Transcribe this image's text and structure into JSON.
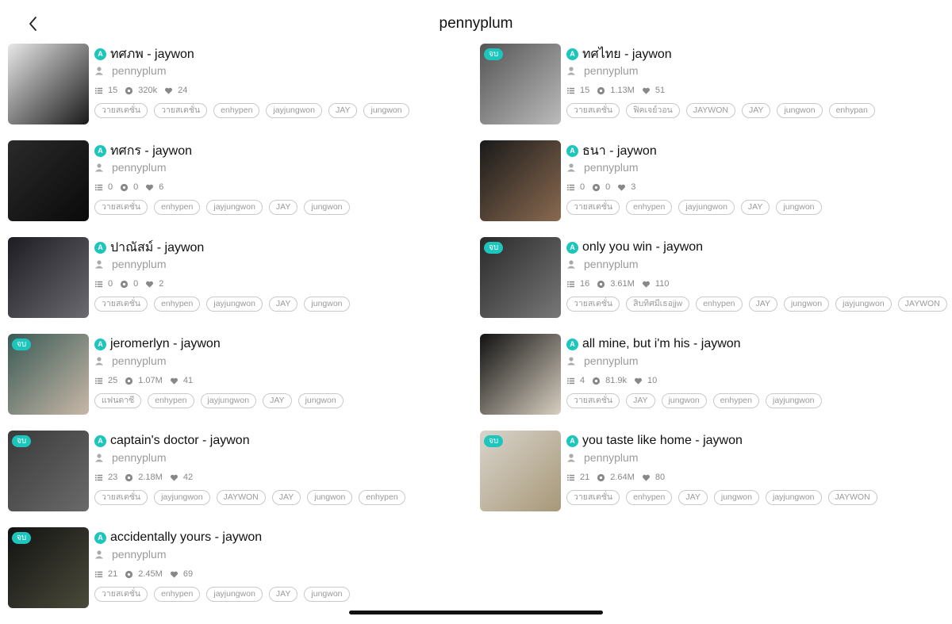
{
  "header": {
    "title": "pennyplum"
  },
  "colors": {
    "accent": "#1dc6bd"
  },
  "badge_letter": "A",
  "columns": {
    "left": [
      {
        "title": "ทศภพ - jaywon",
        "author": "pennyplum",
        "chapters": "15",
        "views": "320k",
        "likes": "24",
        "finished": false,
        "tags": [
          "วายสเตชั่น",
          "วายสเตชั่น",
          "enhypen",
          "jayjungwon",
          "JAY",
          "jungwon"
        ]
      },
      {
        "title": "ทศกร - jaywon",
        "author": "pennyplum",
        "chapters": "0",
        "views": "0",
        "likes": "6",
        "finished": false,
        "tags": [
          "วายสเตชั่น",
          "enhypen",
          "jayjungwon",
          "JAY",
          "jungwon"
        ]
      },
      {
        "title": "ปาณัสม์ - jaywon",
        "author": "pennyplum",
        "chapters": "0",
        "views": "0",
        "likes": "2",
        "finished": false,
        "tags": [
          "วายสเตชั่น",
          "enhypen",
          "jayjungwon",
          "JAY",
          "jungwon"
        ]
      },
      {
        "title": "jeromerlyn - jaywon",
        "author": "pennyplum",
        "chapters": "25",
        "views": "1.07M",
        "likes": "41",
        "finished": true,
        "finished_label": "จบ",
        "tags": [
          "แฟนตาซี",
          "enhypen",
          "jayjungwon",
          "JAY",
          "jungwon"
        ]
      },
      {
        "title": "captain's doctor - jaywon",
        "author": "pennyplum",
        "chapters": "23",
        "views": "2.18M",
        "likes": "42",
        "finished": true,
        "finished_label": "จบ",
        "tags": [
          "วายสเตชั่น",
          "jayjungwon",
          "JAYWON",
          "JAY",
          "jungwon",
          "enhypen"
        ]
      },
      {
        "title": "accidentally yours - jaywon",
        "author": "pennyplum",
        "chapters": "21",
        "views": "2.45M",
        "likes": "69",
        "finished": true,
        "finished_label": "จบ",
        "tags": [
          "วายสเตชั่น",
          "enhypen",
          "jayjungwon",
          "JAY",
          "jungwon"
        ]
      }
    ],
    "right": [
      {
        "title": "ทศไทย - jaywon",
        "author": "pennyplum",
        "chapters": "15",
        "views": "1.13M",
        "likes": "51",
        "finished": true,
        "finished_label": "จบ",
        "tags": [
          "วายสเตชั่น",
          "ฟิคเจย์วอน",
          "JAYWON",
          "JAY",
          "jungwon",
          "enhypan"
        ]
      },
      {
        "title": "ธนา - jaywon",
        "author": "pennyplum",
        "chapters": "0",
        "views": "0",
        "likes": "3",
        "finished": false,
        "tags": [
          "วายสเตชั่น",
          "enhypen",
          "jayjungwon",
          "JAY",
          "jungwon"
        ]
      },
      {
        "title": "only you win - jaywon",
        "author": "pennyplum",
        "chapters": "16",
        "views": "3.61M",
        "likes": "110",
        "finished": true,
        "finished_label": "จบ",
        "tags": [
          "วายสเตชั่น",
          "สิบทิศมีเธอjjw",
          "enhypen",
          "JAY",
          "jungwon",
          "jayjungwon",
          "JAYWON"
        ]
      },
      {
        "title": "all mine, but i'm his - jaywon",
        "author": "pennyplum",
        "chapters": "4",
        "views": "81.9k",
        "likes": "10",
        "finished": false,
        "tags": [
          "วายสเตชั่น",
          "JAY",
          "jungwon",
          "enhypen",
          "jayjungwon"
        ]
      },
      {
        "title": "you taste like home - jaywon",
        "author": "pennyplum",
        "chapters": "21",
        "views": "2.64M",
        "likes": "80",
        "finished": true,
        "finished_label": "จบ",
        "tags": [
          "วายสเตชั่น",
          "enhypen",
          "JAY",
          "jungwon",
          "jayjungwon",
          "JAYWON"
        ]
      }
    ]
  },
  "thumb_colors": {
    "left": [
      [
        "#e8e8e8",
        "#1a1a1a"
      ],
      [
        "#2a2a2a",
        "#0a0a0a"
      ],
      [
        "#1c1c22",
        "#6a6a70"
      ],
      [
        "#3a5a55",
        "#c8b8a8"
      ],
      [
        "#3a3a3a",
        "#6a6a6a"
      ],
      [
        "#121212",
        "#4a4a3a"
      ]
    ],
    "right": [
      [
        "#555",
        "#bbb"
      ],
      [
        "#1a1a1a",
        "#8a6a50"
      ],
      [
        "#2a2a2a",
        "#777"
      ],
      [
        "#111",
        "#d8cfc0"
      ],
      [
        "#d8d4cc",
        "#a89878"
      ]
    ]
  }
}
